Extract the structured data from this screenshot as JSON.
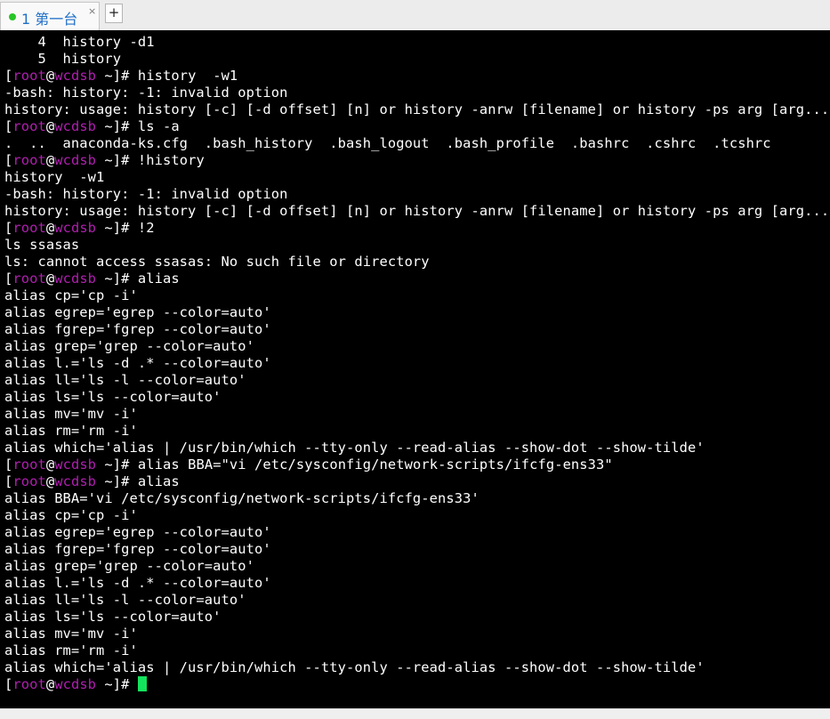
{
  "tab": {
    "label": "1 第一台",
    "close": "×",
    "new_tab": "+"
  },
  "colors": {
    "prompt_user": "#b11fb1",
    "cursor": "#14e35d",
    "tab_active_dot": "#27c527"
  },
  "prompt": {
    "open": "[",
    "user": "root",
    "at": "@",
    "host": "wcdsb",
    "dir": " ~",
    "close": "]# "
  },
  "lines": [
    {
      "text": "    4  history -d1"
    },
    {
      "text": "    5  history"
    },
    {
      "prompt": true,
      "cmd": "history  -w1"
    },
    {
      "text": "-bash: history: -1: invalid option"
    },
    {
      "text": "history: usage: history [-c] [-d offset] [n] or history -anrw [filename] or history -ps arg [arg...]"
    },
    {
      "prompt": true,
      "cmd": "ls -a"
    },
    {
      "text": ".  ..  anaconda-ks.cfg  .bash_history  .bash_logout  .bash_profile  .bashrc  .cshrc  .tcshrc"
    },
    {
      "prompt": true,
      "cmd": "!history"
    },
    {
      "text": "history  -w1"
    },
    {
      "text": "-bash: history: -1: invalid option"
    },
    {
      "text": "history: usage: history [-c] [-d offset] [n] or history -anrw [filename] or history -ps arg [arg...]"
    },
    {
      "prompt": true,
      "cmd": "!2"
    },
    {
      "text": "ls ssasas"
    },
    {
      "text": "ls: cannot access ssasas: No such file or directory"
    },
    {
      "prompt": true,
      "cmd": "alias"
    },
    {
      "text": "alias cp='cp -i'"
    },
    {
      "text": "alias egrep='egrep --color=auto'"
    },
    {
      "text": "alias fgrep='fgrep --color=auto'"
    },
    {
      "text": "alias grep='grep --color=auto'"
    },
    {
      "text": "alias l.='ls -d .* --color=auto'"
    },
    {
      "text": "alias ll='ls -l --color=auto'"
    },
    {
      "text": "alias ls='ls --color=auto'"
    },
    {
      "text": "alias mv='mv -i'"
    },
    {
      "text": "alias rm='rm -i'"
    },
    {
      "text": "alias which='alias | /usr/bin/which --tty-only --read-alias --show-dot --show-tilde'"
    },
    {
      "prompt": true,
      "cmd": "alias BBA=\"vi /etc/sysconfig/network-scripts/ifcfg-ens33\""
    },
    {
      "prompt": true,
      "cmd": "alias"
    },
    {
      "text": "alias BBA='vi /etc/sysconfig/network-scripts/ifcfg-ens33'"
    },
    {
      "text": "alias cp='cp -i'"
    },
    {
      "text": "alias egrep='egrep --color=auto'"
    },
    {
      "text": "alias fgrep='fgrep --color=auto'"
    },
    {
      "text": "alias grep='grep --color=auto'"
    },
    {
      "text": "alias l.='ls -d .* --color=auto'"
    },
    {
      "text": "alias ll='ls -l --color=auto'"
    },
    {
      "text": "alias ls='ls --color=auto'"
    },
    {
      "text": "alias mv='mv -i'"
    },
    {
      "text": "alias rm='rm -i'"
    },
    {
      "text": "alias which='alias | /usr/bin/which --tty-only --read-alias --show-dot --show-tilde'"
    },
    {
      "prompt": true,
      "cmd": "",
      "cursor": true
    }
  ]
}
